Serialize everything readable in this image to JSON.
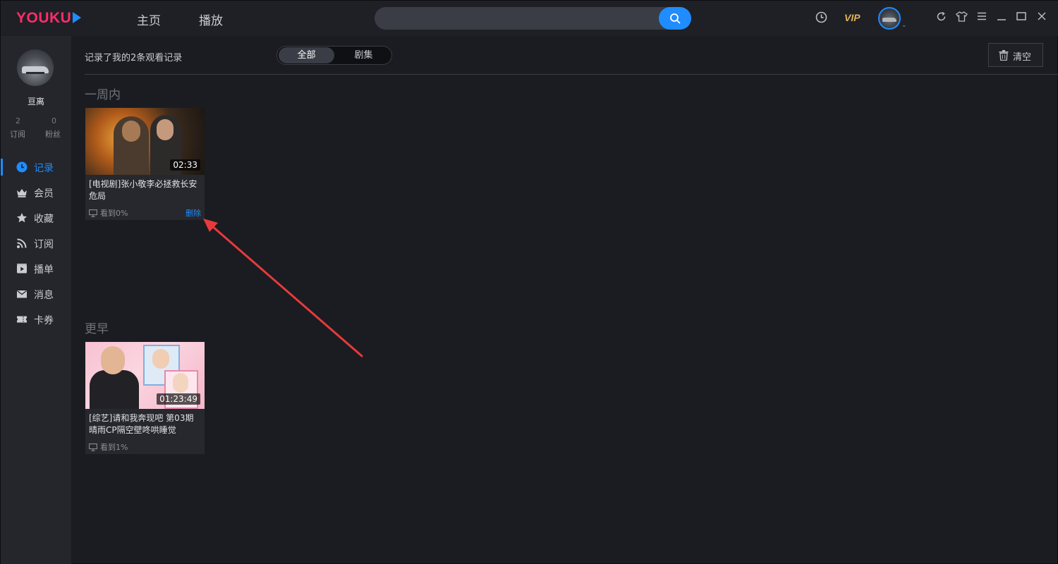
{
  "app": {
    "logo": "YOUKU",
    "brand_color": "#ff2d6a",
    "accent_color": "#1f8cff"
  },
  "topbar": {
    "nav": [
      "主页",
      "播放"
    ],
    "search": {
      "placeholder": ""
    },
    "vip_label": "VIP",
    "icons": [
      "history-icon",
      "avatar",
      "refresh-icon",
      "skin-icon",
      "menu-icon",
      "minimize-icon",
      "maximize-icon",
      "close-icon"
    ]
  },
  "sidebar": {
    "username": "亘离",
    "stats": [
      {
        "value": "2",
        "label": "订阅"
      },
      {
        "value": "0",
        "label": "粉丝"
      }
    ],
    "items": [
      {
        "label": "记录",
        "icon": "clock-icon",
        "active": true
      },
      {
        "label": "会员",
        "icon": "crown-icon",
        "active": false
      },
      {
        "label": "收藏",
        "icon": "star-icon",
        "active": false
      },
      {
        "label": "订阅",
        "icon": "rss-icon",
        "active": false
      },
      {
        "label": "播单",
        "icon": "playlist-icon",
        "active": false
      },
      {
        "label": "消息",
        "icon": "mail-icon",
        "active": false
      },
      {
        "label": "卡券",
        "icon": "ticket-icon",
        "active": false
      }
    ]
  },
  "main": {
    "summary": "记录了我的2条观看记录",
    "filters": [
      "全部",
      "剧集"
    ],
    "selected_filter": "全部",
    "clear_label": "清空",
    "sections": [
      {
        "title": "一周内",
        "items": [
          {
            "title": "[电视剧]张小敬李必拯救长安危局",
            "duration": "02:33",
            "progress": "看到0%",
            "delete_label": "删除"
          }
        ]
      },
      {
        "title": "更早",
        "items": [
          {
            "title": "[综艺]请和我奔现吧 第03期 晴雨CP隔空壁咚哄睡觉",
            "duration": "01:23:49",
            "progress": "看到1%"
          }
        ]
      }
    ]
  },
  "annotation": {
    "type": "red-arrow",
    "color": "#e83a3a"
  }
}
